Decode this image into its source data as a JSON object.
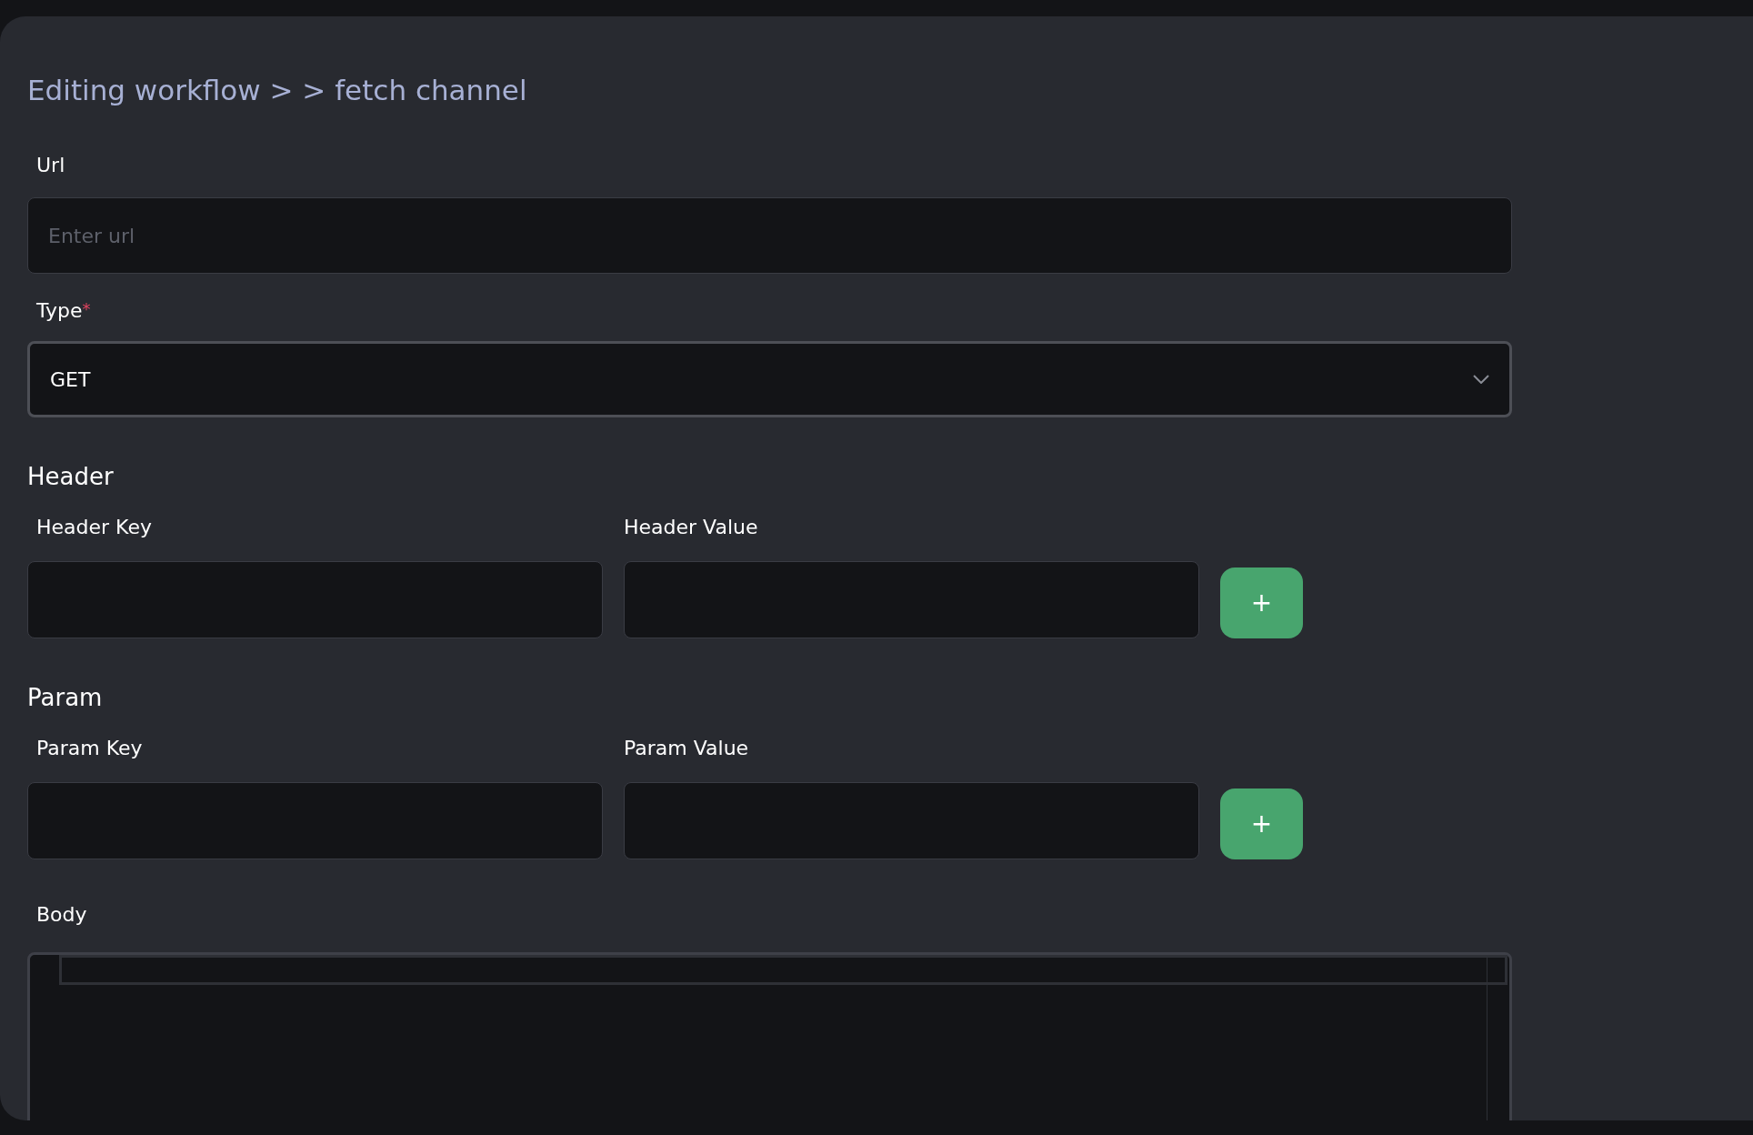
{
  "breadcrumb": "Editing workflow > > fetch channel",
  "url": {
    "label": "Url",
    "placeholder": "Enter url"
  },
  "type": {
    "label": "Type",
    "required_mark": "*",
    "value": "GET"
  },
  "sections": [
    {
      "title": "Header",
      "key_label": "Header Key",
      "value_label": "Header Value",
      "add": "+"
    },
    {
      "title": "Param",
      "key_label": "Param Key",
      "value_label": "Param Value",
      "add": "+"
    }
  ],
  "body": {
    "label": "Body"
  }
}
